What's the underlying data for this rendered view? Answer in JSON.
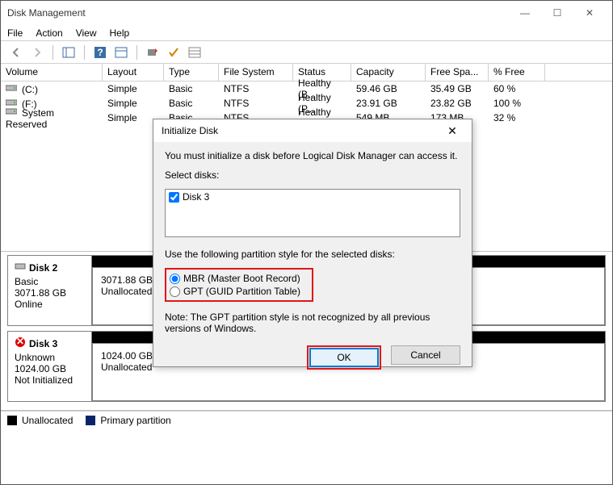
{
  "window": {
    "title": "Disk Management"
  },
  "menu": {
    "file": "File",
    "action": "Action",
    "view": "View",
    "help": "Help"
  },
  "columns": {
    "volume": "Volume",
    "layout": "Layout",
    "type": "Type",
    "fs": "File System",
    "status": "Status",
    "capacity": "Capacity",
    "free": "Free Spa...",
    "pfree": "% Free"
  },
  "volumes": [
    {
      "name": "(C:)",
      "layout": "Simple",
      "type": "Basic",
      "fs": "NTFS",
      "status": "Healthy (B...",
      "cap": "59.46 GB",
      "free": "35.49 GB",
      "pfree": "60 %"
    },
    {
      "name": "(F:)",
      "layout": "Simple",
      "type": "Basic",
      "fs": "NTFS",
      "status": "Healthy (P...",
      "cap": "23.91 GB",
      "free": "23.82 GB",
      "pfree": "100 %"
    },
    {
      "name": "System Reserved",
      "layout": "Simple",
      "type": "Basic",
      "fs": "NTFS",
      "status": "Healthy (S...",
      "cap": "549 MB",
      "free": "173 MB",
      "pfree": "32 %"
    }
  ],
  "disks": [
    {
      "name": "Disk 2",
      "type": "Basic",
      "size": "3071.88 GB",
      "state": "Online",
      "alloc_size": "3071.88 GB",
      "alloc_state": "Unallocated",
      "error": false
    },
    {
      "name": "Disk 3",
      "type": "Unknown",
      "size": "1024.00 GB",
      "state": "Not Initialized",
      "alloc_size": "1024.00 GB",
      "alloc_state": "Unallocated",
      "error": true
    }
  ],
  "legend": {
    "unalloc": "Unallocated",
    "primary": "Primary partition"
  },
  "dialog": {
    "title": "Initialize Disk",
    "msg": "You must initialize a disk before Logical Disk Manager can access it.",
    "select_label": "Select disks:",
    "disk_option": "Disk 3",
    "style_label": "Use the following partition style for the selected disks:",
    "mbr": "MBR (Master Boot Record)",
    "gpt": "GPT (GUID Partition Table)",
    "note": "Note: The GPT partition style is not recognized by all previous versions of Windows.",
    "ok": "OK",
    "cancel": "Cancel"
  }
}
